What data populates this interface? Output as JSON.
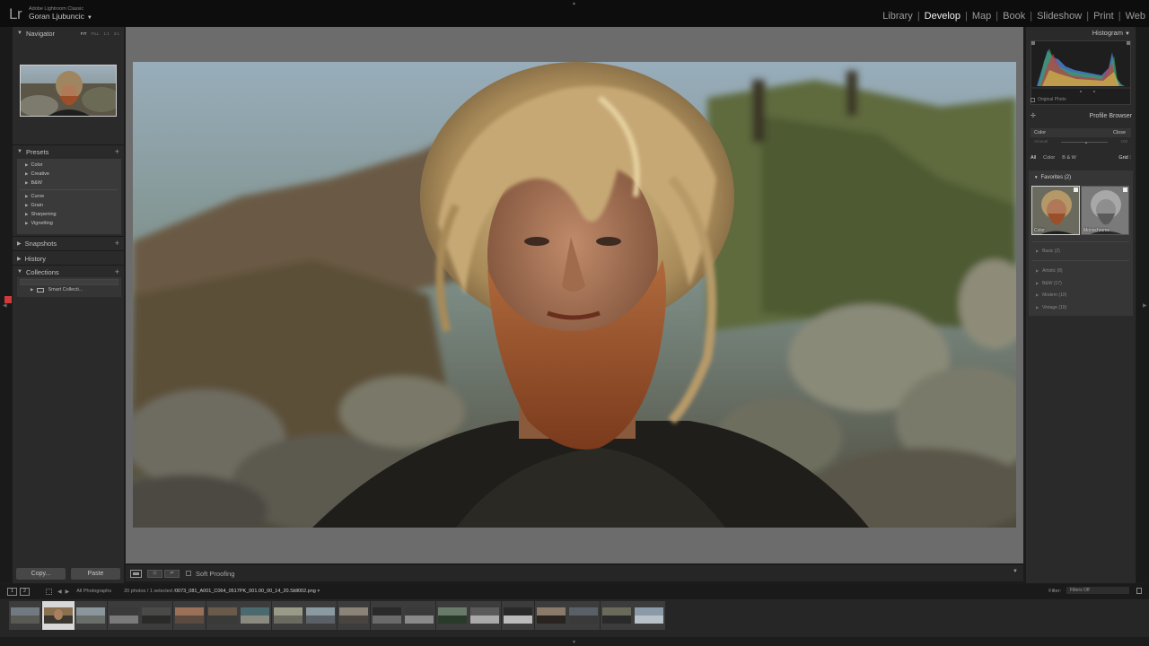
{
  "app": {
    "logo": "Lr",
    "product": "Adobe Lightroom Classic",
    "user": "Goran Ljubuncic"
  },
  "modules": [
    "Library",
    "Develop",
    "Map",
    "Book",
    "Slideshow",
    "Print",
    "Web"
  ],
  "active_module": "Develop",
  "left": {
    "navigator": {
      "title": "Navigator",
      "modes": [
        "FIT",
        "FILL",
        "1:1",
        "3:1"
      ]
    },
    "presets": {
      "title": "Presets",
      "group1": [
        "Color",
        "Creative",
        "B&W"
      ],
      "group2": [
        "Curve",
        "Grain",
        "Sharpening",
        "Vignetting"
      ]
    },
    "snapshots": "Snapshots",
    "history": "History",
    "collections": {
      "title": "Collections",
      "item": "Smart Collecti..."
    },
    "copy_button": "Copy...",
    "paste_button": "Paste"
  },
  "toolbar": {
    "soft_proofing": "Soft Proofing"
  },
  "right": {
    "histogram": "Histogram",
    "original_photo": "Original Photo",
    "profile_browser": "Profile Browser",
    "profile_row": {
      "name": "Color",
      "close": "Close"
    },
    "amount": {
      "label": "Amount",
      "value": "100"
    },
    "filters": [
      "All",
      "Color",
      "B & W"
    ],
    "grid": "Grid",
    "favorites": {
      "title": "Favorites (2)",
      "items": [
        "Color",
        "Monochrome"
      ]
    },
    "groups": [
      "Basic (2)",
      "Artistic (8)",
      "B&W (17)",
      "Modern (10)",
      "Vintage (10)"
    ]
  },
  "filmstrip": {
    "pages": [
      "1",
      "2"
    ],
    "source": "All Photographs",
    "info_prefix": "20 photos / 1 selected /",
    "filename": "0073_081_A001_C064_0517PK_001.00_00_14_20.Still002.png",
    "filter_label": "Filter:",
    "filter_value": "Filters Off",
    "thumb_count": 20,
    "selected_index": 1
  },
  "colors": {
    "active_module": "#f0f0f0",
    "panel_bg": "#2a2a2a",
    "canvas_bg": "#6c6c6c",
    "flag_red": "#d13a3a"
  }
}
